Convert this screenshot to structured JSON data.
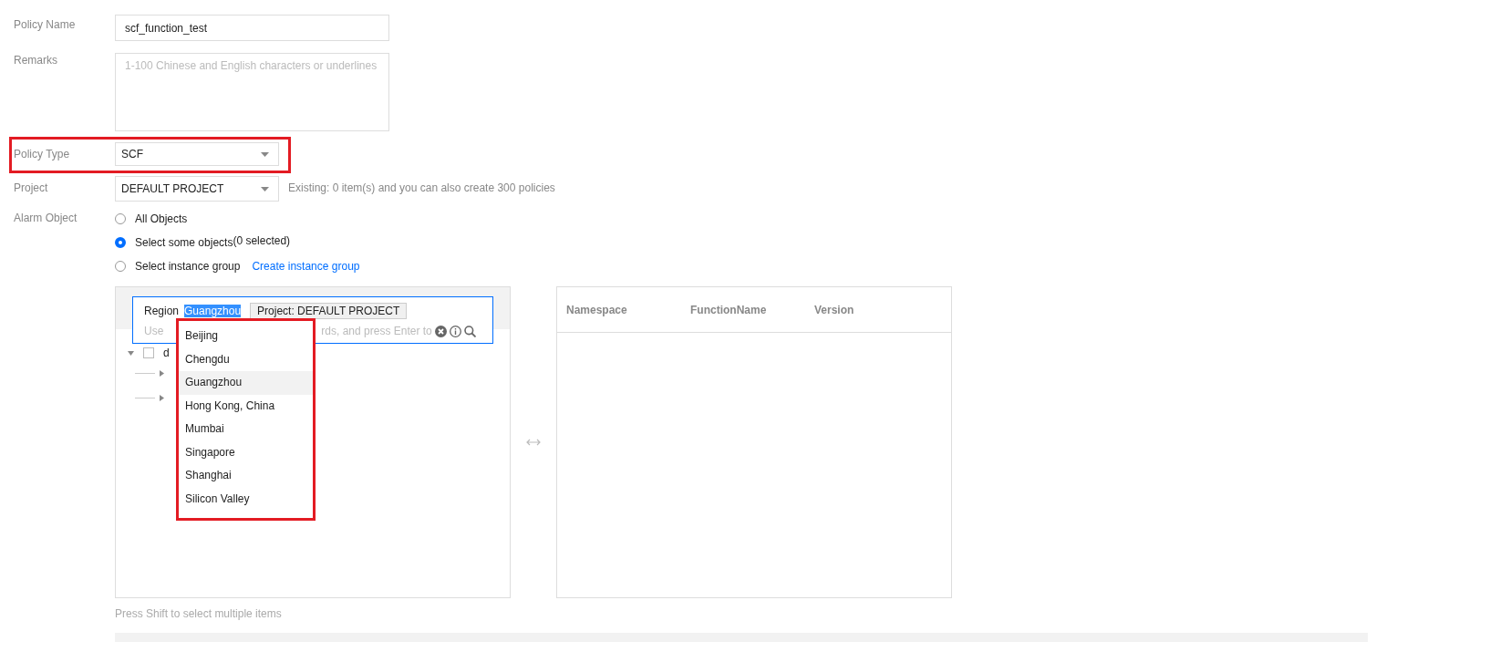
{
  "form": {
    "policy_name": {
      "label": "Policy Name",
      "value": "scf_function_test"
    },
    "remarks": {
      "label": "Remarks",
      "placeholder": "1-100 Chinese and English characters or underlines"
    },
    "policy_type": {
      "label": "Policy Type",
      "value": "SCF",
      "highlighted": true
    },
    "project": {
      "label": "Project",
      "value": "DEFAULT PROJECT",
      "hint": "Existing: 0 item(s) and you can also create 300 policies"
    },
    "alarm_object": {
      "label": "Alarm Object",
      "options": [
        {
          "label": "All Objects",
          "selected": false
        },
        {
          "label": "Select some objects",
          "note": "(0 selected)",
          "selected": true
        },
        {
          "label": "Select instance group",
          "link": "Create instance group",
          "selected": false
        }
      ]
    }
  },
  "picker": {
    "search": {
      "label": "Region",
      "tags": [
        {
          "text": "Guangzhou",
          "kind": "selected-text"
        },
        {
          "text": "Project: DEFAULT PROJECT",
          "kind": "tag"
        }
      ],
      "placeholder_parts": [
        "Use",
        "rds, and press Enter to"
      ]
    },
    "tree": {
      "label": "d",
      "expanded": true,
      "checked": false,
      "children": [
        {
          "expanded": false
        },
        {
          "expanded": false
        }
      ]
    },
    "dropdown": {
      "highlighted": true,
      "items": [
        {
          "label": "Beijing",
          "selected": false
        },
        {
          "label": "Chengdu",
          "selected": false
        },
        {
          "label": "Guangzhou",
          "selected": true
        },
        {
          "label": "Hong Kong, China",
          "selected": false
        },
        {
          "label": "Mumbai",
          "selected": false
        },
        {
          "label": "Singapore",
          "selected": false
        },
        {
          "label": "Shanghai",
          "selected": false
        },
        {
          "label": "Silicon Valley",
          "selected": false
        }
      ]
    },
    "table": {
      "columns": [
        "Namespace",
        "FunctionName",
        "Version"
      ]
    },
    "hint": "Press Shift to select multiple items"
  }
}
